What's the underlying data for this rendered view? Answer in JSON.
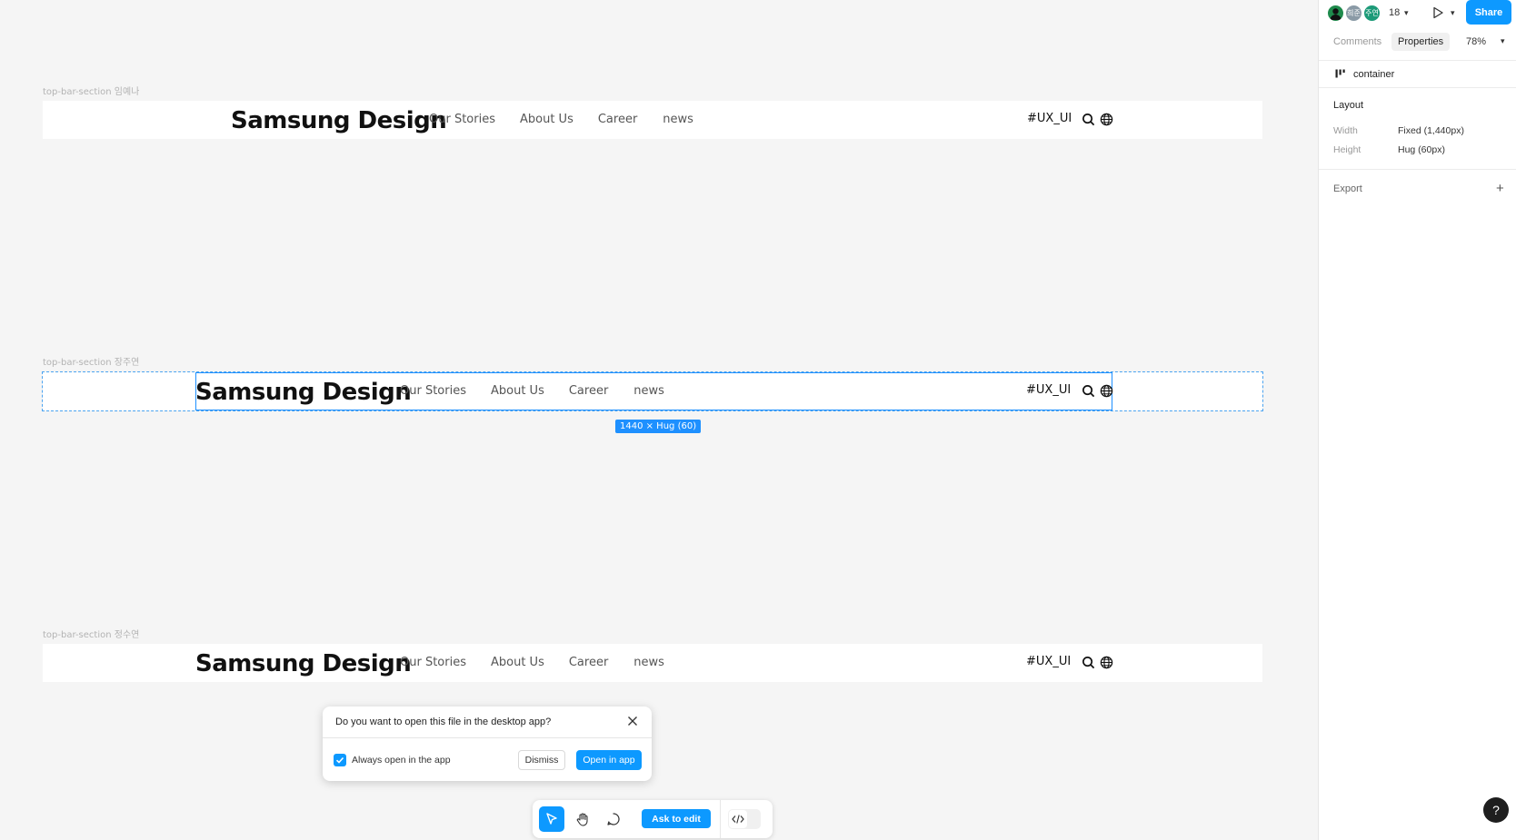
{
  "frames": [
    {
      "label": "top-bar-section 임예나",
      "logo": "Samsung Design",
      "nav": [
        "Our Stories",
        "About Us",
        "Career",
        "news"
      ],
      "hashtag": "#UX_UI"
    },
    {
      "label": "top-bar-section 장주연",
      "logo": "Samsung Design",
      "nav": [
        "Our Stories",
        "About Us",
        "Career",
        "news"
      ],
      "hashtag": "#UX_UI",
      "size_badge": "1440 × Hug (60)"
    },
    {
      "label": "top-bar-section 정수연",
      "logo": "Samsung Design",
      "nav": [
        "Our Stories",
        "About Us",
        "Career",
        "news"
      ],
      "hashtag": "#UX_UI"
    }
  ],
  "panel": {
    "avatars": [
      "",
      "희준",
      "주연"
    ],
    "viewer_count": "18",
    "share_label": "Share",
    "tabs": [
      "Comments",
      "Properties"
    ],
    "zoom": "78%",
    "layer_name": "container",
    "layout_title": "Layout",
    "width_label": "Width",
    "width_value": "Fixed (1,440px)",
    "height_label": "Height",
    "height_value": "Hug (60px)",
    "export_title": "Export",
    "help_label": "?"
  },
  "dialog": {
    "title": "Do you want to open this file in the desktop app?",
    "checkbox_label": "Always open in the app",
    "checkbox_checked": true,
    "dismiss_label": "Dismiss",
    "open_label": "Open in app"
  },
  "toolbar": {
    "ask_label": "Ask to edit"
  },
  "colors": {
    "accent": "#0d99ff",
    "selection": "#1e90ff",
    "canvas": "#f5f5f5"
  }
}
